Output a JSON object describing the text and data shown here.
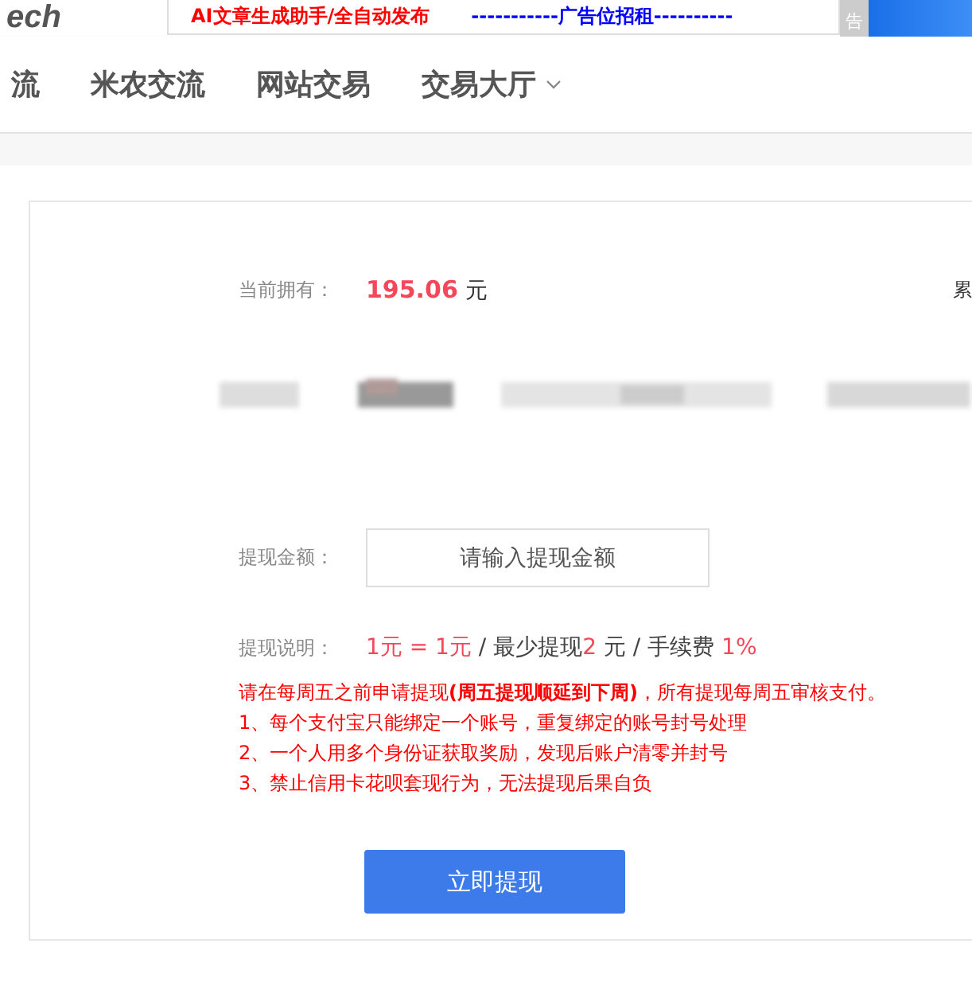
{
  "header": {
    "logo": "ech",
    "ad_texts": [
      {
        "text": "AI文章生成助手/全自动发布",
        "color": "#ff0000"
      },
      {
        "text": "-----------广告位招租----------",
        "color": "#0000ff"
      }
    ],
    "ad_tag": "告"
  },
  "nav": {
    "items": [
      {
        "label": "流",
        "dropdown": false
      },
      {
        "label": "米农交流",
        "dropdown": false
      },
      {
        "label": "网站交易",
        "dropdown": false
      },
      {
        "label": "交易大厅",
        "dropdown": true
      }
    ]
  },
  "balance": {
    "label": "当前拥有：",
    "amount": "195.06",
    "unit": "元",
    "right_text": "累"
  },
  "amount_field": {
    "label": "提现金额：",
    "placeholder": "请输入提现金额"
  },
  "rules": {
    "label": "提现说明：",
    "parts": [
      {
        "text": "1元 = 1元",
        "highlight": true
      },
      {
        "text": " / 最少提现",
        "highlight": false
      },
      {
        "text": "2",
        "highlight": true
      },
      {
        "text": " 元 / 手续费 ",
        "highlight": false
      },
      {
        "text": "1%",
        "highlight": true
      }
    ],
    "notes": [
      "请在每周五之前申请提现**(周五提现顺延到下周)**，所有提现每周五审核支付。",
      "1、每个支付宝只能绑定一个账号，重复绑定的账号封号处理",
      "2、一个人用多个身份证获取奖励，发现后账户清零并封号",
      "3、禁止信用卡花呗套现行为，无法提现后果自负"
    ]
  },
  "submit": "立即提现"
}
